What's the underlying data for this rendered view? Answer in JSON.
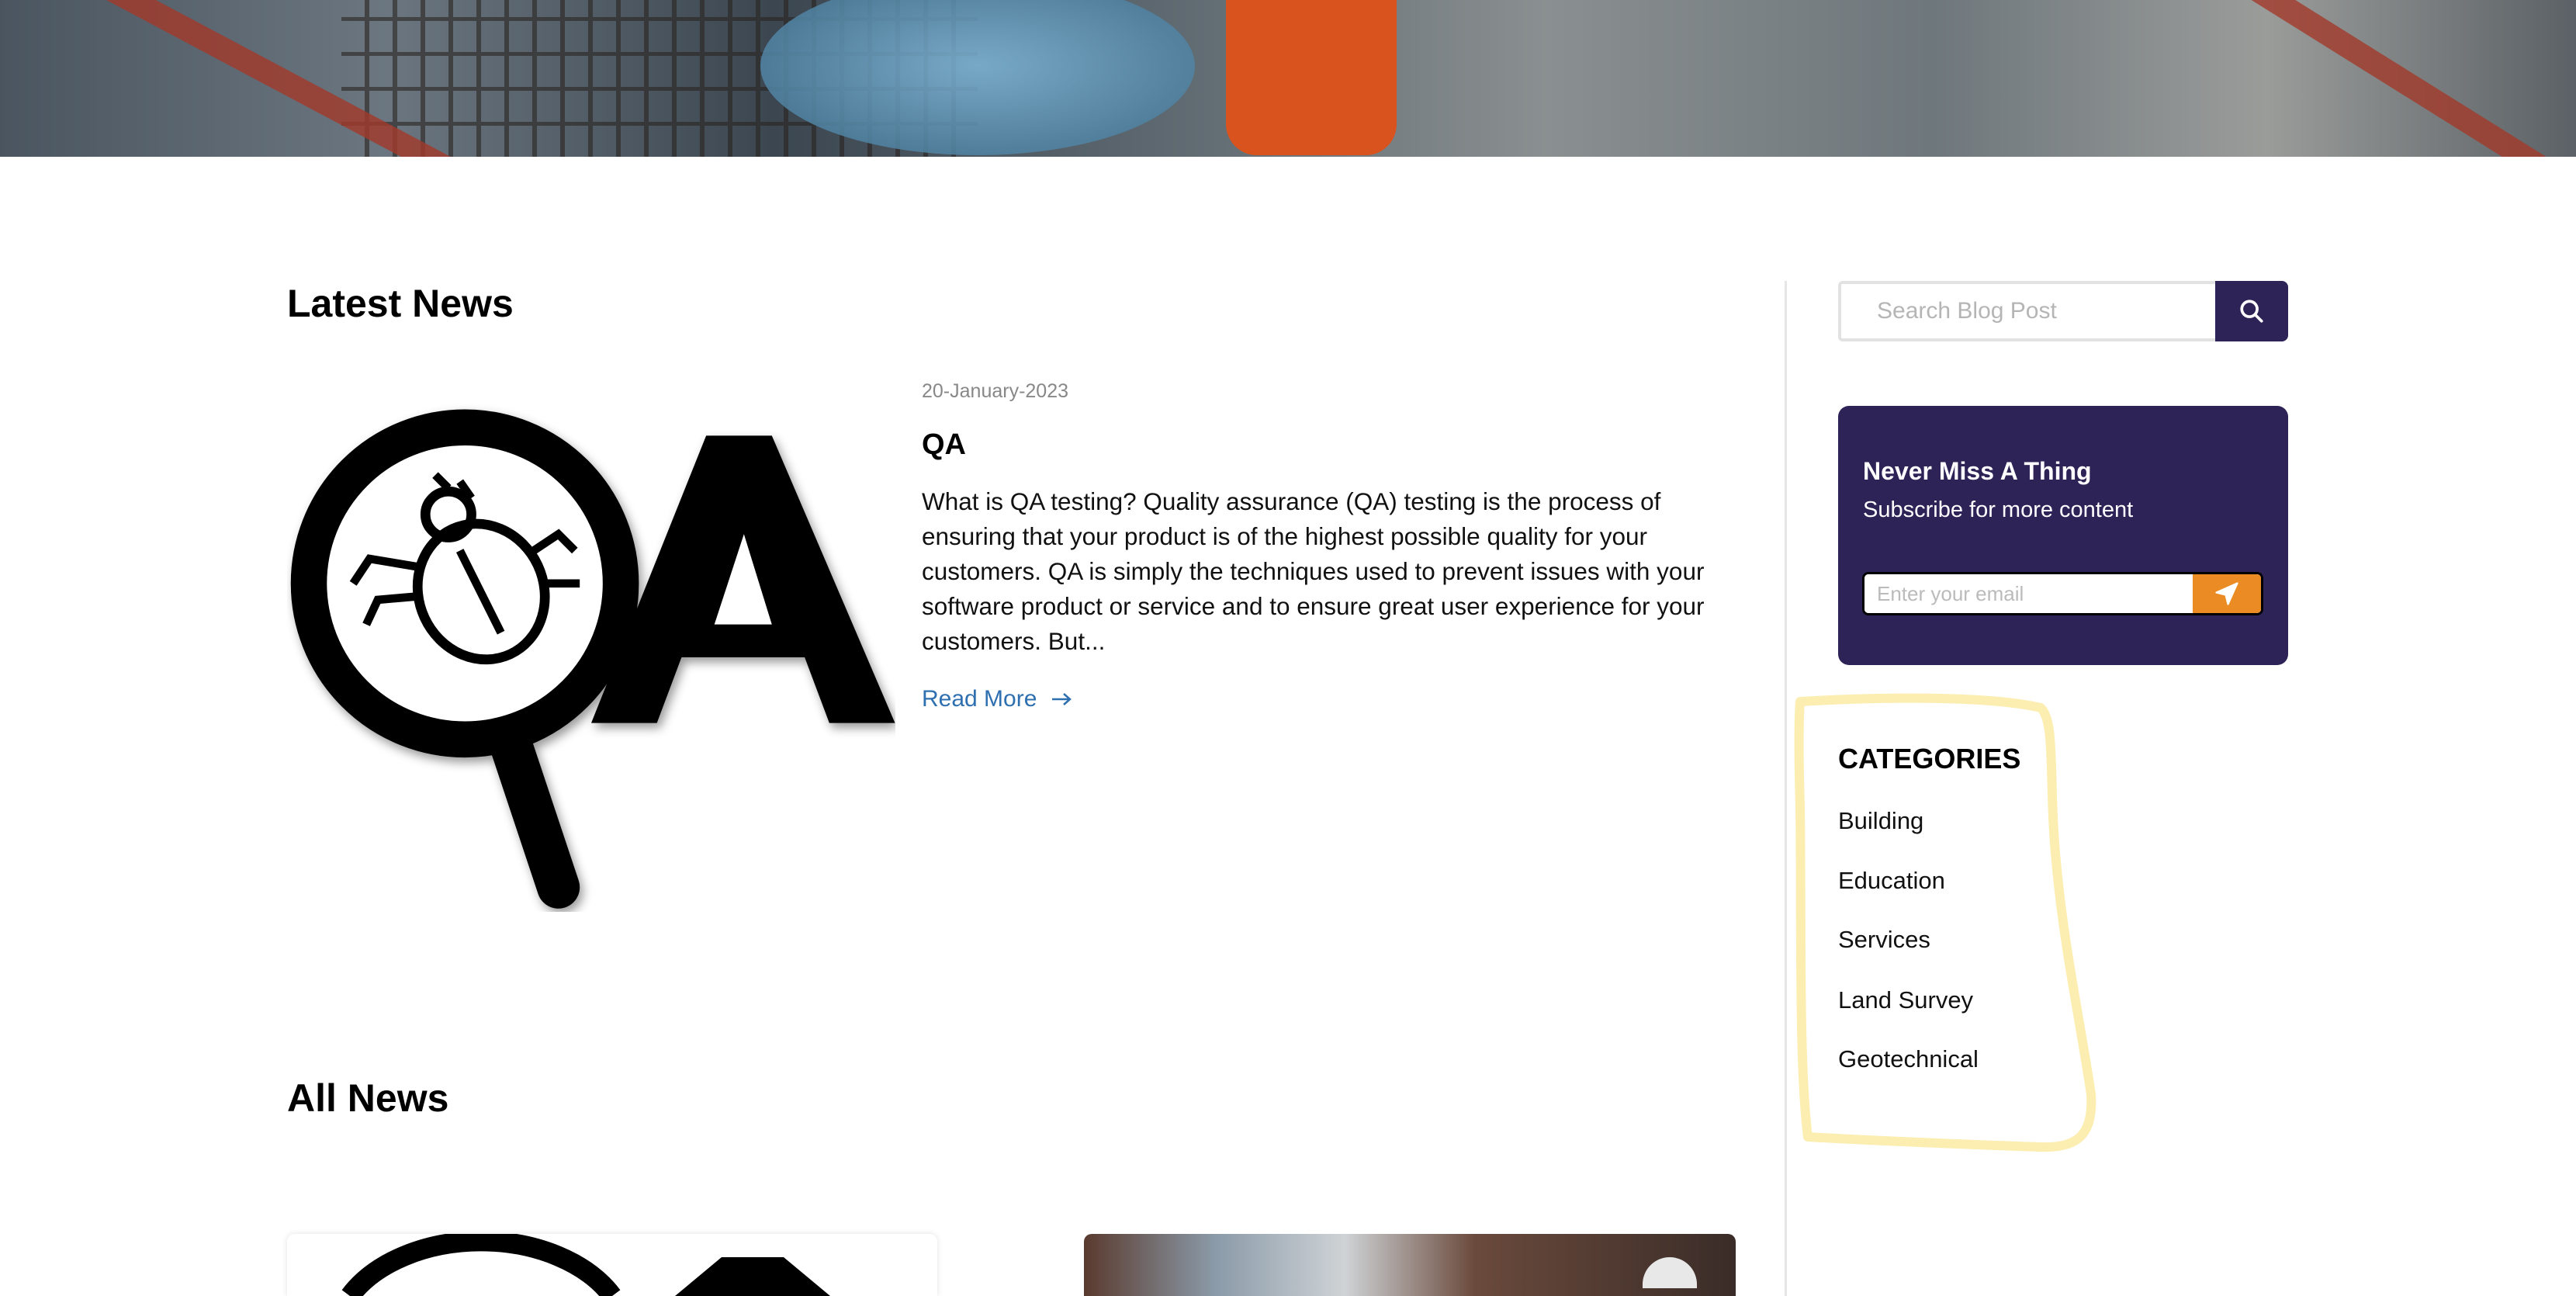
{
  "latest": {
    "heading": "Latest News",
    "post": {
      "date": "20-January-2023",
      "title": "QA",
      "excerpt": "What is QA testing? Quality assurance (QA) testing is the process of ensuring that your product is of the highest possible quality for your customers. QA is simply the techniques used to prevent issues with your software product or service and to ensure great user experience for your customers. But...",
      "read_more": "Read More",
      "image_text": "QA"
    }
  },
  "all_news": {
    "heading": "All News"
  },
  "sidebar": {
    "search": {
      "placeholder": "Search Blog Post",
      "icon": "search-icon"
    },
    "newsletter": {
      "title": "Never Miss A Thing",
      "subtitle": "Subscribe for more content",
      "email_placeholder": "Enter your email",
      "icon": "send-icon"
    },
    "categories": {
      "heading": "CATEGORIES",
      "items": [
        "Building",
        "Education",
        "Services",
        "Land Survey",
        "Geotechnical"
      ]
    }
  },
  "colors": {
    "brand": "#2d2357",
    "accent": "#ea8b24",
    "link": "#2e6fb0",
    "highlight": "#fbeeb0"
  }
}
